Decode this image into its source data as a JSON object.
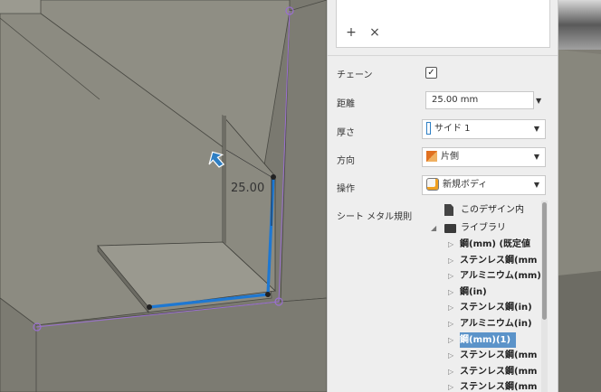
{
  "viewport": {
    "dimension_text": "25.00"
  },
  "selection_box": {
    "add_label": "+",
    "remove_label": "×"
  },
  "params": {
    "chain_label": "チェーン",
    "chain_checked": "✓",
    "distance_label": "距離",
    "distance_value": "25.00 mm",
    "thickness_label": "厚さ",
    "thickness_value": "サイド 1",
    "direction_label": "方向",
    "direction_value": "片側",
    "operation_label": "操作",
    "operation_value": "新規ボディ",
    "rules_label": "シート メタル規則"
  },
  "tree": {
    "design_label": "このデザイン内",
    "library_label": "ライブラリ",
    "items": [
      {
        "label": "鋼(mm) (既定値",
        "bold": true,
        "selected": false
      },
      {
        "label": "ステンレス鋼(mm",
        "bold": true,
        "selected": false
      },
      {
        "label": "アルミニウム(mm)",
        "bold": true,
        "selected": false
      },
      {
        "label": "鋼(in)",
        "bold": true,
        "selected": false
      },
      {
        "label": "ステンレス鋼(in)",
        "bold": true,
        "selected": false
      },
      {
        "label": "アルミニウム(in)",
        "bold": true,
        "selected": false
      },
      {
        "label": "鋼(mm)(1)",
        "bold": true,
        "selected": true
      },
      {
        "label": "ステンレス鋼(mm",
        "bold": true,
        "selected": false
      },
      {
        "label": "ステンレス鋼(mm",
        "bold": true,
        "selected": false
      },
      {
        "label": "ステンレス鋼(mm",
        "bold": true,
        "selected": false
      }
    ]
  },
  "colors": {
    "edge_highlight": "#1e78d2",
    "selection_bg": "#5b93c9",
    "model_face": "#8a897f"
  }
}
